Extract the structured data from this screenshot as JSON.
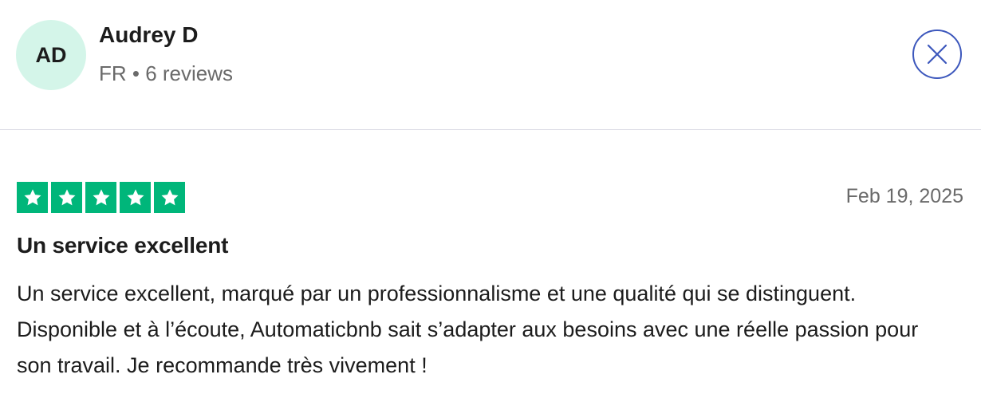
{
  "reviewer": {
    "initials": "AD",
    "name": "Audrey D",
    "meta": "FR • 6 reviews"
  },
  "review": {
    "rating": 5,
    "rating_max": 5,
    "star_color": "#00b67a",
    "date": "Feb 19, 2025",
    "title": "Un service excellent",
    "body": "Un service excellent, marqué par un professionnalisme et une qualité qui se distinguent. Disponible et à l’écoute, Automaticbnb sait s’adapter aux besoins avec une réelle passion pour son travail. Je recommande très vivement !"
  },
  "close_button": {
    "icon": "close-icon",
    "color": "#3c57bc"
  },
  "colors": {
    "avatar_bg": "#d4f5e9",
    "divider": "#dcdce6"
  }
}
